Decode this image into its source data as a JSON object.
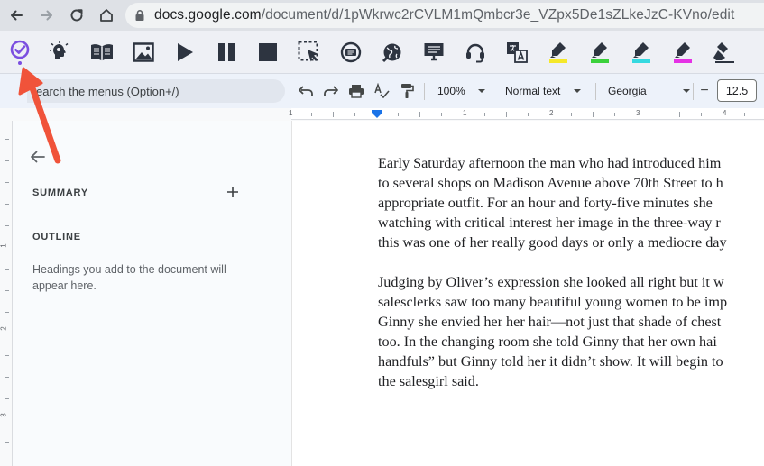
{
  "browser": {
    "url_host": "docs.google.com",
    "url_path": "/document/d/1pWkrwc2rCVLM1mQmbcr3e_VZpx5De1sZLkeJzC-KVno/edit"
  },
  "extension_toolbar": {
    "buttons": [
      "checkmark-logo-icon",
      "brain-icon",
      "book-icon",
      "image-icon",
      "play-icon",
      "pause-icon",
      "stop-icon",
      "screen-select-icon",
      "audio-icon",
      "globe-icon",
      "monitor-icon",
      "headset-icon",
      "translate-icon",
      "highlight-yellow-icon",
      "highlight-green-icon",
      "highlight-cyan-icon",
      "highlight-magenta-icon",
      "highlighter-clear-icon"
    ],
    "highlight_colors": [
      "#f5e829",
      "#3bd13b",
      "#35d9e0",
      "#e532e5"
    ]
  },
  "docs_toolbar": {
    "search_placeholder": "earch the menus (Option+/)",
    "zoom": "100%",
    "style": "Normal text",
    "font": "Georgia",
    "font_size_minus": "−",
    "font_size": "12.5"
  },
  "ruler": {
    "labels": [
      "1",
      "1",
      "2",
      "3",
      "4"
    ],
    "vertical_labels": [
      "1",
      "2",
      "3"
    ]
  },
  "outline_panel": {
    "summary_label": "SUMMARY",
    "add_summary": "+",
    "outline_label": "OUTLINE",
    "hint": "Headings you add to the document will appear here."
  },
  "document": {
    "lines": [
      "Early Saturday afternoon the man who had introduced him",
      "to several shops on Madison Avenue above 70th Street to h",
      "appropriate outfit. For an hour and forty-five minutes she",
      "watching with critical interest her image in the three-way r",
      "this was one of her really good days or only a mediocre day",
      "",
      "Judging by Oliver’s expression she looked all right but it w",
      "salesclerks saw too many beautiful young women to be imp",
      "Ginny she envied her her hair—not just that shade of chest",
      "too. In the changing room she told Ginny that her own hai",
      "handfuls” but Ginny told her it didn’t show. It will begin to",
      "the salesgirl said."
    ]
  },
  "colors": {
    "accent_purple": "#7b4fe0",
    "annotation_red": "#f0533a",
    "ruler_indent_blue": "#1a73e8"
  }
}
